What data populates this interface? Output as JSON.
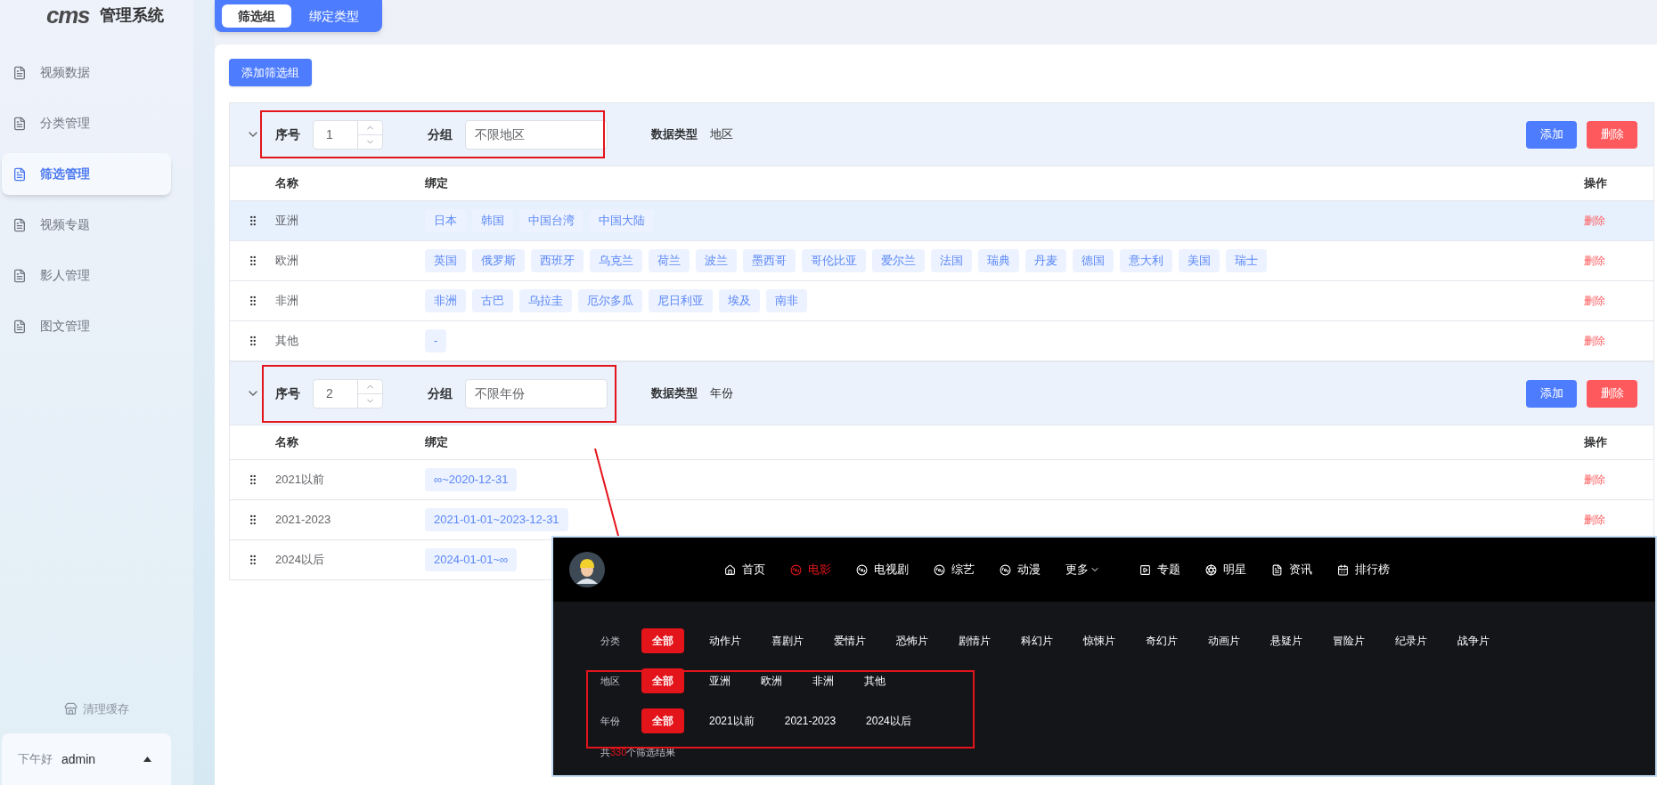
{
  "sidebar": {
    "logo": "cms",
    "title": "管理系统",
    "items": [
      {
        "label": "视频数据",
        "selected": false
      },
      {
        "label": "分类管理",
        "selected": false
      },
      {
        "label": "筛选管理",
        "selected": true
      },
      {
        "label": "视频专题",
        "selected": false
      },
      {
        "label": "影人管理",
        "selected": false
      },
      {
        "label": "图文管理",
        "selected": false
      }
    ],
    "clear_cache": "清理缓存",
    "user": {
      "greeting": "下午好",
      "name": "admin"
    }
  },
  "tabs": [
    {
      "label": "筛选组",
      "selected": true
    },
    {
      "label": "绑定类型",
      "selected": false
    }
  ],
  "add_group_button": "添加筛选组",
  "groups": [
    {
      "expanded": true,
      "order_label": "序号",
      "order": "1",
      "group_label": "分组",
      "group_value": "不限地区",
      "type_label": "数据类型",
      "type_value": "地区",
      "add_button": "添加",
      "delete_button": "删除",
      "columns": [
        "名称",
        "绑定",
        "操作"
      ],
      "rows": [
        {
          "name": "亚洲",
          "highlighted": true,
          "bindings": [
            "日本",
            "韩国",
            "中国台湾",
            "中国大陆"
          ],
          "action": "删除"
        },
        {
          "name": "欧洲",
          "highlighted": false,
          "bindings": [
            "英国",
            "俄罗斯",
            "西班牙",
            "乌克兰",
            "荷兰",
            "波兰",
            "墨西哥",
            "哥伦比亚",
            "爱尔兰",
            "法国",
            "瑞典",
            "丹麦",
            "德国",
            "意大利",
            "美国",
            "瑞士"
          ],
          "action": "删除"
        },
        {
          "name": "非洲",
          "highlighted": false,
          "bindings": [
            "非洲",
            "古巴",
            "乌拉圭",
            "厄尔多瓜",
            "尼日利亚",
            "埃及",
            "南非"
          ],
          "action": "删除"
        },
        {
          "name": "其他",
          "highlighted": false,
          "bindings": [
            "-"
          ],
          "action": "删除"
        }
      ]
    },
    {
      "expanded": true,
      "order_label": "序号",
      "order": "2",
      "group_label": "分组",
      "group_value": "不限年份",
      "type_label": "数据类型",
      "type_value": "年份",
      "add_button": "添加",
      "delete_button": "删除",
      "columns": [
        "名称",
        "绑定",
        "操作"
      ],
      "rows": [
        {
          "name": "2021以前",
          "highlighted": false,
          "bindings": [
            "∞~2020-12-31"
          ],
          "action": "删除"
        },
        {
          "name": "2021-2023",
          "highlighted": false,
          "bindings": [
            "2021-01-01~2023-12-31"
          ],
          "action": "删除"
        },
        {
          "name": "2024以后",
          "highlighted": false,
          "bindings": [
            "2024-01-01~∞"
          ]
        }
      ]
    }
  ],
  "preview": {
    "nav": [
      {
        "label": "首页",
        "kind": "home",
        "selected": false
      },
      {
        "label": "电影",
        "kind": "reel",
        "selected": true
      },
      {
        "label": "电视剧",
        "kind": "reel",
        "selected": false
      },
      {
        "label": "综艺",
        "kind": "reel",
        "selected": false
      },
      {
        "label": "动漫",
        "kind": "reel",
        "selected": false
      },
      {
        "label": "更多",
        "kind": "more",
        "selected": false
      },
      {
        "label": "专题",
        "kind": "play",
        "selected": false
      },
      {
        "label": "明星",
        "kind": "star",
        "selected": false
      },
      {
        "label": "资讯",
        "kind": "doc",
        "selected": false
      },
      {
        "label": "排行榜",
        "kind": "calendar",
        "selected": false
      }
    ],
    "filters": [
      {
        "label": "分类",
        "options": [
          {
            "label": "全部",
            "selected": true
          },
          {
            "label": "动作片",
            "selected": false
          },
          {
            "label": "喜剧片",
            "selected": false
          },
          {
            "label": "爱情片",
            "selected": false
          },
          {
            "label": "恐怖片",
            "selected": false
          },
          {
            "label": "剧情片",
            "selected": false
          },
          {
            "label": "科幻片",
            "selected": false
          },
          {
            "label": "惊悚片",
            "selected": false
          },
          {
            "label": "奇幻片",
            "selected": false
          },
          {
            "label": "动画片",
            "selected": false
          },
          {
            "label": "悬疑片",
            "selected": false
          },
          {
            "label": "冒险片",
            "selected": false
          },
          {
            "label": "纪录片",
            "selected": false
          },
          {
            "label": "战争片",
            "selected": false
          }
        ]
      },
      {
        "label": "地区",
        "options": [
          {
            "label": "全部",
            "selected": true
          },
          {
            "label": "亚洲",
            "selected": false
          },
          {
            "label": "欧洲",
            "selected": false
          },
          {
            "label": "非洲",
            "selected": false
          },
          {
            "label": "其他",
            "selected": false
          }
        ]
      },
      {
        "label": "年份",
        "options": [
          {
            "label": "全部",
            "selected": true
          },
          {
            "label": "2021以前",
            "selected": false
          },
          {
            "label": "2021-2023",
            "selected": false
          },
          {
            "label": "2024以后",
            "selected": false
          }
        ]
      }
    ],
    "result": {
      "prefix": "共",
      "count": "330",
      "suffix": "个筛选结果"
    }
  }
}
